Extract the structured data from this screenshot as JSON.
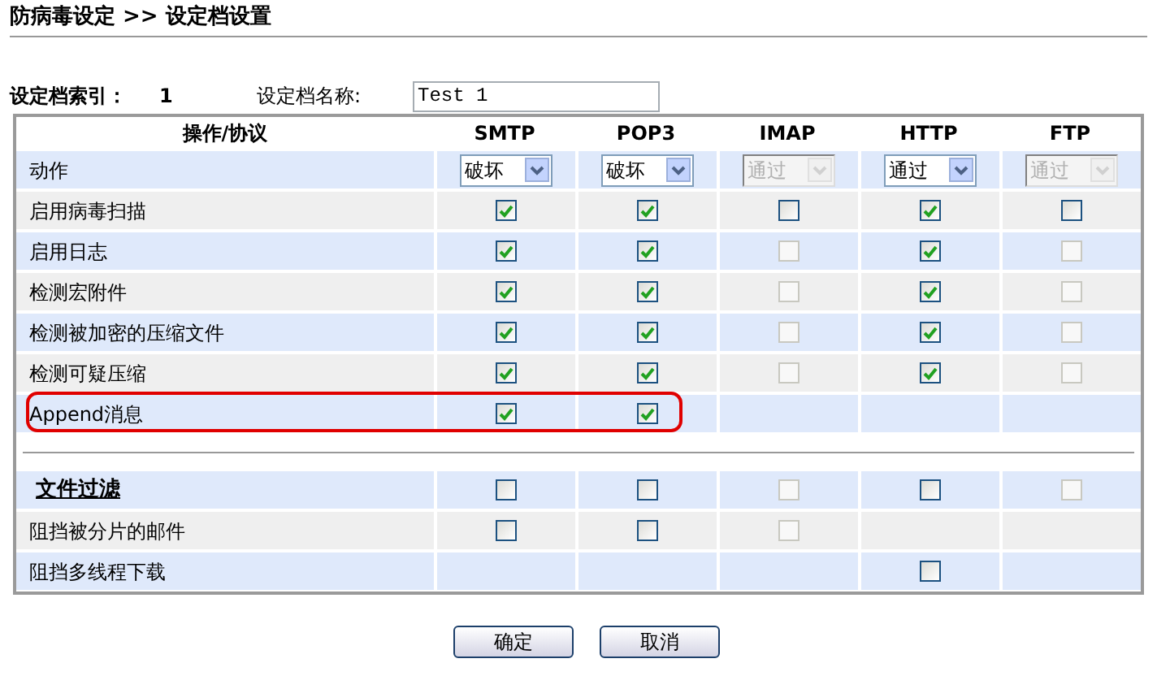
{
  "page_title": "防病毒设定 >> 设定档设置",
  "profile": {
    "index_label": "设定档索引：",
    "index_value": "1",
    "name_label": "设定档名称:",
    "name_value": "Test 1"
  },
  "table": {
    "columns": [
      "操作/协议",
      "SMTP",
      "POP3",
      "IMAP",
      "HTTP",
      "FTP"
    ],
    "rows": [
      {
        "kind": "select",
        "label": "动作",
        "highlighted": false,
        "cells": [
          {
            "kind": "select",
            "value": "破坏",
            "disabled": false
          },
          {
            "kind": "select",
            "value": "破坏",
            "disabled": false
          },
          {
            "kind": "select",
            "value": "通过",
            "disabled": true
          },
          {
            "kind": "select",
            "value": "通过",
            "disabled": false
          },
          {
            "kind": "select",
            "value": "通过",
            "disabled": true
          }
        ]
      },
      {
        "kind": "option",
        "label": "启用病毒扫描",
        "highlighted": false,
        "cells": [
          {
            "kind": "checkbox",
            "checked": true,
            "disabled": false
          },
          {
            "kind": "checkbox",
            "checked": true,
            "disabled": false
          },
          {
            "kind": "checkbox",
            "checked": false,
            "disabled": false
          },
          {
            "kind": "checkbox",
            "checked": true,
            "disabled": false
          },
          {
            "kind": "checkbox",
            "checked": false,
            "disabled": false
          }
        ]
      },
      {
        "kind": "option",
        "label": "启用日志",
        "highlighted": false,
        "cells": [
          {
            "kind": "checkbox",
            "checked": true,
            "disabled": false
          },
          {
            "kind": "checkbox",
            "checked": true,
            "disabled": false
          },
          {
            "kind": "checkbox",
            "checked": false,
            "disabled": true
          },
          {
            "kind": "checkbox",
            "checked": true,
            "disabled": false
          },
          {
            "kind": "checkbox",
            "checked": false,
            "disabled": true
          }
        ]
      },
      {
        "kind": "option",
        "label": "检测宏附件",
        "highlighted": false,
        "cells": [
          {
            "kind": "checkbox",
            "checked": true,
            "disabled": false
          },
          {
            "kind": "checkbox",
            "checked": true,
            "disabled": false
          },
          {
            "kind": "checkbox",
            "checked": false,
            "disabled": true
          },
          {
            "kind": "checkbox",
            "checked": true,
            "disabled": false
          },
          {
            "kind": "checkbox",
            "checked": false,
            "disabled": true
          }
        ]
      },
      {
        "kind": "option",
        "label": "检测被加密的压缩文件",
        "highlighted": false,
        "cells": [
          {
            "kind": "checkbox",
            "checked": true,
            "disabled": false
          },
          {
            "kind": "checkbox",
            "checked": true,
            "disabled": false
          },
          {
            "kind": "checkbox",
            "checked": false,
            "disabled": true
          },
          {
            "kind": "checkbox",
            "checked": true,
            "disabled": false
          },
          {
            "kind": "checkbox",
            "checked": false,
            "disabled": true
          }
        ]
      },
      {
        "kind": "option",
        "label": "检测可疑压缩",
        "highlighted": false,
        "cells": [
          {
            "kind": "checkbox",
            "checked": true,
            "disabled": false
          },
          {
            "kind": "checkbox",
            "checked": true,
            "disabled": false
          },
          {
            "kind": "checkbox",
            "checked": false,
            "disabled": true
          },
          {
            "kind": "checkbox",
            "checked": true,
            "disabled": false
          },
          {
            "kind": "checkbox",
            "checked": false,
            "disabled": true
          }
        ]
      },
      {
        "kind": "option",
        "label": "Append消息",
        "highlighted": true,
        "cells": [
          {
            "kind": "checkbox",
            "checked": true,
            "disabled": false
          },
          {
            "kind": "checkbox",
            "checked": true,
            "disabled": false
          },
          {
            "kind": "empty"
          },
          {
            "kind": "empty"
          },
          {
            "kind": "empty"
          }
        ]
      },
      {
        "kind": "divider"
      },
      {
        "kind": "section",
        "label": "文件过滤",
        "highlighted": false,
        "cells": [
          {
            "kind": "checkbox",
            "checked": false,
            "disabled": false
          },
          {
            "kind": "checkbox",
            "checked": false,
            "disabled": false
          },
          {
            "kind": "checkbox",
            "checked": false,
            "disabled": true
          },
          {
            "kind": "checkbox",
            "checked": false,
            "disabled": false
          },
          {
            "kind": "checkbox",
            "checked": false,
            "disabled": true
          }
        ]
      },
      {
        "kind": "option",
        "label": "阻挡被分片的邮件",
        "highlighted": false,
        "cells": [
          {
            "kind": "checkbox",
            "checked": false,
            "disabled": false
          },
          {
            "kind": "checkbox",
            "checked": false,
            "disabled": false
          },
          {
            "kind": "checkbox",
            "checked": false,
            "disabled": true
          },
          {
            "kind": "empty"
          },
          {
            "kind": "empty"
          }
        ]
      },
      {
        "kind": "option",
        "label": "阻挡多线程下载",
        "highlighted": false,
        "cells": [
          {
            "kind": "empty"
          },
          {
            "kind": "empty"
          },
          {
            "kind": "empty"
          },
          {
            "kind": "checkbox",
            "checked": false,
            "disabled": false
          },
          {
            "kind": "empty"
          }
        ]
      }
    ]
  },
  "buttons": [
    "确定",
    "取消"
  ]
}
